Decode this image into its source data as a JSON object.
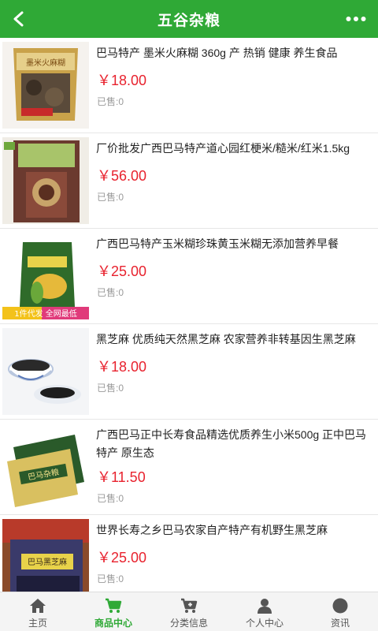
{
  "header": {
    "title": "五谷杂粮",
    "back_icon": "chevron-left-icon",
    "more_icon": "more-dots-icon",
    "background": "#2fa936"
  },
  "products": [
    {
      "name": "巴马特产 墨米火麻糊 360g 产 热销 健康 养生食品",
      "price": "￥18.00",
      "sold": "已售:0",
      "image_text": "墨米火麻糊"
    },
    {
      "name": "厂价批发广西巴马特产道心园红梗米/糙米/红米1.5kg",
      "price": "￥56.00",
      "sold": "已售:0",
      "image_text": ""
    },
    {
      "name": "广西巴马特产玉米糊珍珠黄玉米糊无添加营养早餐",
      "price": "￥25.00",
      "sold": "已售:0",
      "image_text": "1件代发 全网最低"
    },
    {
      "name": "黑芝麻 优质纯天然黑芝麻 农家营养非转基因生黑芝麻",
      "price": "￥18.00",
      "sold": "已售:0",
      "image_text": ""
    },
    {
      "name": "广西巴马正中长寿食品精选优质养生小米500g 正中巴马特产 原生态",
      "price": "￥11.50",
      "sold": "已售:0",
      "image_text": "巴马杂粮"
    },
    {
      "name": "世界长寿之乡巴马农家自产特产有机野生黑芝麻",
      "price": "￥25.00",
      "sold": "已售:0",
      "image_text": "巴马黑芝麻"
    }
  ],
  "tabbar": {
    "active_color": "#2fa936",
    "items": [
      {
        "label": "主页",
        "icon": "home-icon"
      },
      {
        "label": "商品中心",
        "icon": "cart-icon"
      },
      {
        "label": "分类信息",
        "icon": "cart-plus-icon"
      },
      {
        "label": "个人中心",
        "icon": "user-icon"
      },
      {
        "label": "资讯",
        "icon": "circle-icon"
      }
    ]
  }
}
